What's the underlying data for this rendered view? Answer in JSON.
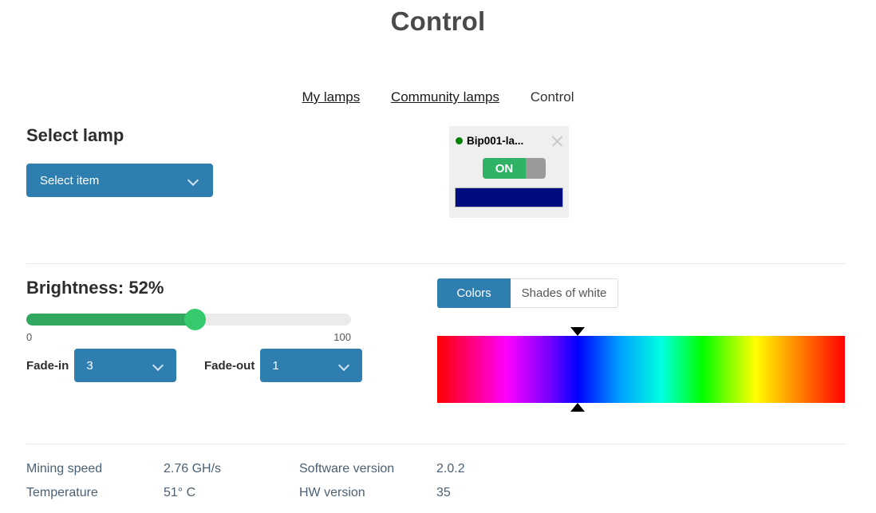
{
  "page_title": "Control",
  "nav": {
    "items": [
      {
        "label": "My lamps",
        "current": false
      },
      {
        "label": "Community lamps",
        "current": false
      },
      {
        "label": "Control",
        "current": true
      }
    ]
  },
  "select_lamp": {
    "heading": "Select lamp",
    "dropdown_value": "Select item"
  },
  "lamp_card": {
    "name": "Bip001-la...",
    "status_color": "#008000",
    "toggle_label": "ON",
    "toggle_state": "on",
    "swatch_color": "#000b7f"
  },
  "brightness": {
    "heading": "Brightness: 52%",
    "value": 52,
    "min_label": "0",
    "max_label": "100",
    "fill_color": "#30a85f",
    "handle_color": "#37ca6d"
  },
  "fade": {
    "in_label": "Fade-in",
    "in_value": "3",
    "out_label": "Fade-out",
    "out_value": "1"
  },
  "color_tabs": {
    "items": [
      {
        "label": "Colors",
        "active": true
      },
      {
        "label": "Shades of white",
        "active": false
      }
    ],
    "marker_position_pct": 34.5
  },
  "stats": {
    "rows": [
      {
        "key": "Mining speed",
        "value": "2.76 GH/s",
        "key2": "Software version",
        "value2": "2.0.2"
      },
      {
        "key": "Temperature",
        "value": "51° C",
        "key2": "HW version",
        "value2": "35"
      }
    ]
  }
}
